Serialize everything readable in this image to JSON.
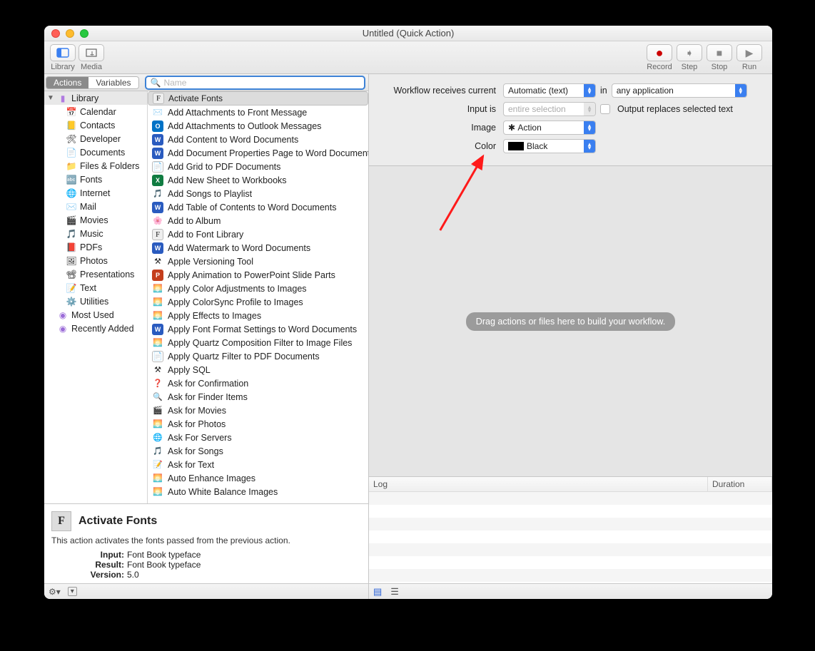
{
  "window": {
    "title": "Untitled (Quick Action)"
  },
  "toolbar": {
    "library": "Library",
    "media": "Media",
    "record": "Record",
    "step": "Step",
    "stop": "Stop",
    "run": "Run"
  },
  "tabs": {
    "actions": "Actions",
    "variables": "Variables"
  },
  "search": {
    "placeholder": "Name"
  },
  "categories": {
    "header": "Library",
    "items": [
      "Calendar",
      "Contacts",
      "Developer",
      "Documents",
      "Files & Folders",
      "Fonts",
      "Internet",
      "Mail",
      "Movies",
      "Music",
      "PDFs",
      "Photos",
      "Presentations",
      "Text",
      "Utilities"
    ],
    "smart": [
      "Most Used",
      "Recently Added"
    ]
  },
  "actions": [
    "Activate Fonts",
    "Add Attachments to Front Message",
    "Add Attachments to Outlook Messages",
    "Add Content to Word Documents",
    "Add Document Properties Page to Word Documents",
    "Add Grid to PDF Documents",
    "Add New Sheet to Workbooks",
    "Add Songs to Playlist",
    "Add Table of Contents to Word Documents",
    "Add to Album",
    "Add to Font Library",
    "Add Watermark to Word Documents",
    "Apple Versioning Tool",
    "Apply Animation to PowerPoint Slide Parts",
    "Apply Color Adjustments to Images",
    "Apply ColorSync Profile to Images",
    "Apply Effects to Images",
    "Apply Font Format Settings to Word Documents",
    "Apply Quartz Composition Filter to Image Files",
    "Apply Quartz Filter to PDF Documents",
    "Apply SQL",
    "Ask for Confirmation",
    "Ask for Finder Items",
    "Ask for Movies",
    "Ask for Photos",
    "Ask For Servers",
    "Ask for Songs",
    "Ask for Text",
    "Auto Enhance Images",
    "Auto White Balance Images"
  ],
  "details": {
    "title": "Activate Fonts",
    "desc": "This action activates the fonts passed from the previous action.",
    "input_label": "Input:",
    "input_val": "Font Book typeface",
    "result_label": "Result:",
    "result_val": "Font Book typeface",
    "version_label": "Version:",
    "version_val": "5.0"
  },
  "config": {
    "receives_label": "Workflow receives current",
    "receives_val": "Automatic (text)",
    "in_label": "in",
    "in_val": "any application",
    "input_is_label": "Input is",
    "input_is_val": "entire selection",
    "output_replaces": "Output replaces selected text",
    "image_label": "Image",
    "image_val": "Action",
    "color_label": "Color",
    "color_val": "Black"
  },
  "canvas": {
    "placeholder": "Drag actions or files here to build your workflow."
  },
  "log": {
    "col1": "Log",
    "col2": "Duration"
  }
}
